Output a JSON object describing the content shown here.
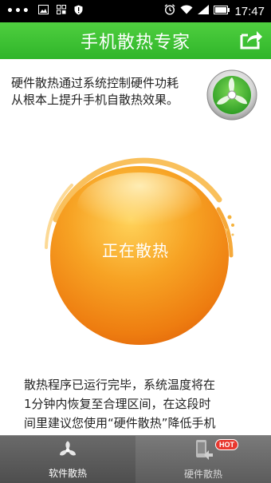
{
  "status_bar": {
    "time": "17:47",
    "dots": "•••",
    "icons": [
      "image-icon",
      "grid-icon",
      "shield-icon",
      "alarm-icon",
      "wifi-icon",
      "signal-icon",
      "battery-icon"
    ]
  },
  "header": {
    "title": "手机散热专家",
    "share_icon": "share-icon"
  },
  "intro": {
    "line1": "硬件散热通过系统控制硬件功耗",
    "line2": "从根本上提升手机自散热效果。",
    "fan_icon": "fan-icon"
  },
  "orb": {
    "label": "正在散热"
  },
  "message": {
    "line1": "散热程序已运行完毕，系统温度将在",
    "line2": "1分钟内恢复至合理区间，在这段时",
    "line3": "间里建议您使用“硬件散热”降低手机"
  },
  "bottom_nav": {
    "tabs": [
      {
        "label": "软件散热",
        "icon": "fan-tab-icon",
        "active": true
      },
      {
        "label": "硬件散热",
        "icon": "phone-tab-icon",
        "active": false,
        "badge": "HOT"
      }
    ]
  },
  "colors": {
    "accent_green": "#2fb52a",
    "orb_orange": "#f59a18",
    "badge_red": "#e8382f"
  }
}
